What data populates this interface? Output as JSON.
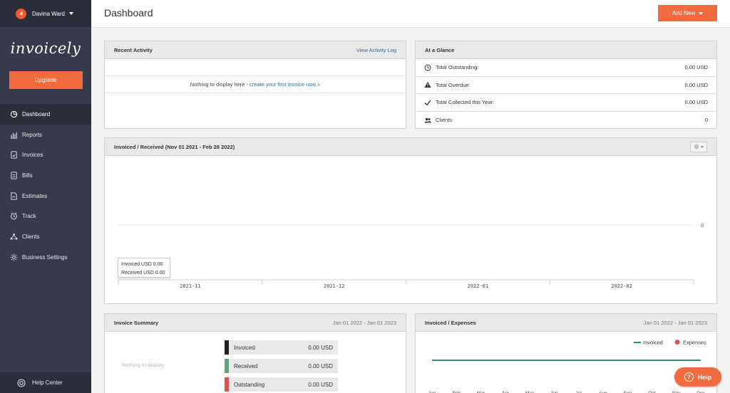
{
  "user": {
    "name": "Davina Ward"
  },
  "brand": {
    "logo_text": "invoicely",
    "accent": "#f06b3f"
  },
  "sidebar": {
    "upgrade_label": "Upgrade",
    "items": [
      {
        "label": "Dashboard",
        "icon": "pie-chart-icon",
        "active": true
      },
      {
        "label": "Reports",
        "icon": "bar-chart-icon"
      },
      {
        "label": "Invoices",
        "icon": "invoice-icon"
      },
      {
        "label": "Bills",
        "icon": "bill-icon"
      },
      {
        "label": "Estimates",
        "icon": "estimate-icon"
      },
      {
        "label": "Track",
        "icon": "clock-icon"
      },
      {
        "label": "Clients",
        "icon": "clients-icon"
      },
      {
        "label": "Business Settings",
        "icon": "gear-icon"
      }
    ],
    "help_center": "Help Center"
  },
  "header": {
    "title": "Dashboard",
    "add_new": "Add New"
  },
  "recent_activity": {
    "title": "Recent Activity",
    "link": "View Activity Log",
    "empty_text": "Nothing to display here -",
    "empty_link": "create your first invoice now »"
  },
  "at_a_glance": {
    "title": "At a Glance",
    "rows": [
      {
        "label": "Total Outstanding:",
        "value": "0.00 USD",
        "icon": "clock-icon"
      },
      {
        "label": "Total Overdue:",
        "value": "0.00 USD",
        "icon": "warning-icon"
      },
      {
        "label": "Total Collected this Year:",
        "value": "0.00 USD",
        "icon": "check-icon"
      },
      {
        "label": "Clients:",
        "value": "0",
        "icon": "clients-icon"
      }
    ]
  },
  "invoiced_received": {
    "title": "Invoiced / Received (Nov 01 2021 - Feb 28 2022)",
    "tooltip": {
      "invoiced": "Invoiced USD 0.00",
      "received": "Received USD 0.00"
    }
  },
  "invoice_summary": {
    "title": "Invoice Summary",
    "daterange": "Jan 01 2022 - Jan 01 2023",
    "empty_text": "Nothing to display",
    "rows": [
      {
        "label": "Invoiced",
        "value": "0.00 USD",
        "color": "#222222"
      },
      {
        "label": "Received",
        "value": "0.00 USD",
        "color": "#5fa37a"
      },
      {
        "label": "Outstanding",
        "value": "0.00 USD",
        "color": "#d9534f"
      }
    ]
  },
  "invoiced_expenses": {
    "title": "Invoiced / Expenses",
    "daterange": "Jan 01 2022 - Jan 01 2023",
    "legend": [
      {
        "name": "Invoiced",
        "color": "#3a8c6e"
      },
      {
        "name": "Expenses",
        "color": "#d9534f"
      }
    ]
  },
  "help_button": "Help",
  "chart_data": [
    {
      "type": "bar",
      "categories": [
        "2021-11",
        "2021-12",
        "2022-01",
        "2022-02"
      ],
      "series": [
        {
          "name": "Invoiced",
          "values": [
            0,
            0,
            0,
            0
          ]
        },
        {
          "name": "Received",
          "values": [
            0,
            0,
            0,
            0
          ]
        }
      ],
      "yticks": [
        "0"
      ],
      "grid": true
    },
    {
      "type": "line",
      "categories": [
        "Jan",
        "Feb",
        "Mar",
        "Apr",
        "May",
        "Jun",
        "Jul",
        "Aug",
        "Sep",
        "Oct",
        "Nov",
        "Dec"
      ],
      "series": [
        {
          "name": "Invoiced",
          "values": [
            0,
            0,
            0,
            0,
            0,
            0,
            0,
            0,
            0,
            0,
            0,
            0
          ]
        },
        {
          "name": "Expenses",
          "values": [
            0,
            0,
            0,
            0,
            0,
            0,
            0,
            0,
            0,
            0,
            0,
            0
          ]
        }
      ],
      "legend": "top-right"
    }
  ]
}
